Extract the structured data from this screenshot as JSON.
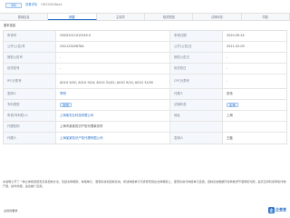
{
  "titlebar": {
    "badge": "专利",
    "link": "查看详情",
    "suffix": "CN112018xxx"
  },
  "tabs": [
    "基础信息",
    "摘要",
    "主权项",
    "相关附图",
    "法律状态",
    "同族"
  ],
  "section_title": "基本信息",
  "rows": [
    {
      "l1": "申请号",
      "v1": "CN202011012545.X",
      "l2": "申请日期",
      "v2": "2020-09-24"
    },
    {
      "l1": "公开(公告)号",
      "v1": "CN112345678A",
      "l2": "公开(公告)日",
      "v2": "2021-02-09"
    },
    {
      "l1": "授权公告号",
      "v1": "-",
      "l2": "授权公告日",
      "v2": "-"
    },
    {
      "l1": "优先权号",
      "v1": "-",
      "l2": "优先权日",
      "v2": "-"
    },
    {
      "l1": "IPC分类号",
      "v1": "A01G 9/02; A01G 9/24; A01G 31/02; A01G 9/14; A01G 31/00",
      "l2": "CPC分类号",
      "v2": "-"
    },
    {
      "l1": "发明人",
      "v1": "李明",
      "l2": "代理人",
      "v2": "张伟"
    },
    {
      "l1": "专利类型",
      "v1": "发明",
      "l2": "法律状态",
      "v2": "实审"
    },
    {
      "l1": "申请(专利权)人",
      "v1": "上海某农业科技有限公司",
      "l2": "地址",
      "v2": "上海"
    },
    {
      "l1": "代理机构",
      "v1": "上海市某某知识产权代理事务所",
      "l2": "",
      "v2": ""
    },
    {
      "l1": "代理人",
      "v1": "上海某某知识产权代理有限公司",
      "l2": "发明人",
      "v2": "王磊"
    }
  ],
  "abstract": "本发明公开了一种立体栽培装置及其控制方法，包括支撑框架、种植单元、灌溉系统和控制系统，所述种植单元可拆卸安装在支撑框架上，灌溉系统与种植单元连通，控制系统根据环境参数调节灌溉和光照，提高空间利用率和作物产量，操作简便，适合推广应用。",
  "footer_label": "主权利要求",
  "logo": {
    "mark": "企",
    "text": "企查查"
  }
}
